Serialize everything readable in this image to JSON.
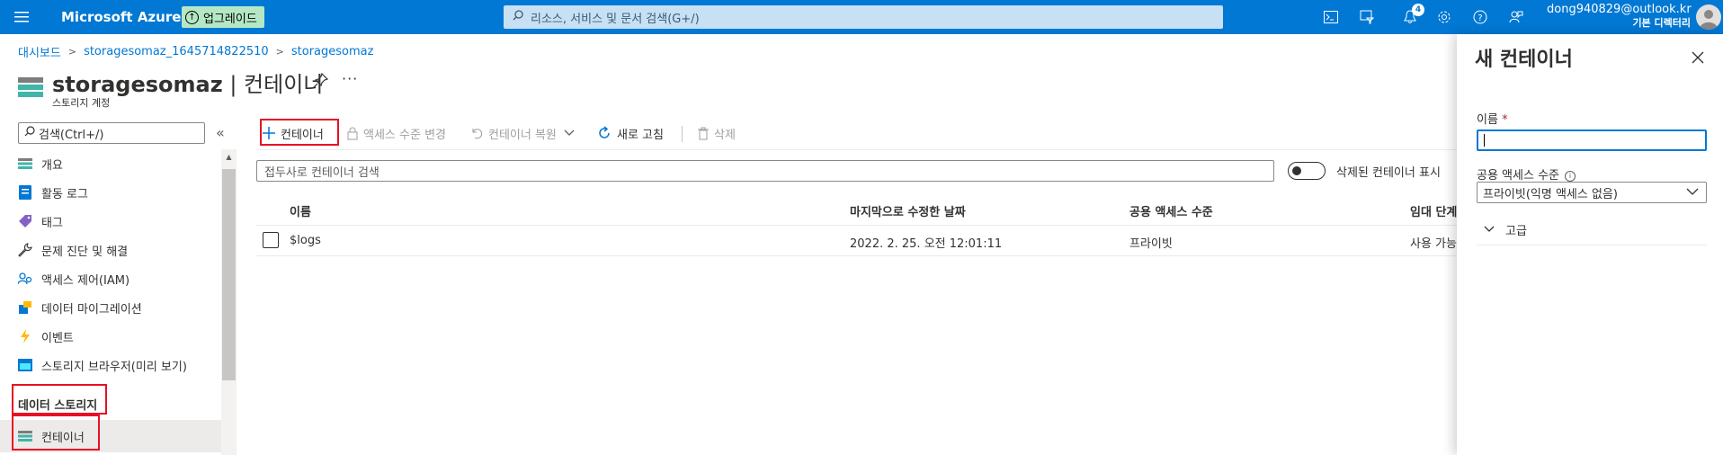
{
  "topbar": {
    "brand": "Microsoft Azure",
    "upgrade_label": "업그레이드",
    "search_placeholder": "리소스, 서비스 및 문서 검색(G+/)",
    "notification_count": "4",
    "user_email": "dong940829@outlook.kr",
    "user_directory": "기본 디렉터리",
    "icons": [
      "cloud-shell-icon",
      "directory-filter-icon",
      "notifications-icon",
      "settings-icon",
      "help-icon",
      "feedback-icon"
    ]
  },
  "breadcrumb": [
    "대시보드",
    "storagesomaz_1645714822510",
    "storagesomaz"
  ],
  "header": {
    "resource_name": "storagesomaz",
    "section": " | 컨테이너",
    "subtitle": "스토리지 계정"
  },
  "sidebar": {
    "search_placeholder": "검색(Ctrl+/)",
    "items": [
      {
        "label": "개요",
        "icon": "overview-icon"
      },
      {
        "label": "활동 로그",
        "icon": "activity-log-icon"
      },
      {
        "label": "태그",
        "icon": "tag-icon"
      },
      {
        "label": "문제 진단 및 해결",
        "icon": "wrench-icon"
      },
      {
        "label": "액세스 제어(IAM)",
        "icon": "iam-icon"
      },
      {
        "label": "데이터 마이그레이션",
        "icon": "migration-icon"
      },
      {
        "label": "이벤트",
        "icon": "lightning-icon"
      },
      {
        "label": "스토리지 브라우저(미리 보기)",
        "icon": "storage-browser-icon"
      }
    ],
    "section_label": "데이터 스토리지",
    "selected_item": {
      "label": "컨테이너",
      "icon": "container-icon"
    }
  },
  "toolbar": {
    "add_container": "컨테이너",
    "change_access": "액세스 수준 변경",
    "restore_container": "컨테이너 복원",
    "refresh": "새로 고침",
    "delete": "삭제"
  },
  "filter": {
    "search_placeholder": "접두사로 컨테이너 검색",
    "show_deleted_label": "삭제된 컨테이너 표시",
    "show_deleted_on": false
  },
  "table": {
    "columns": [
      "이름",
      "마지막으로 수정한 날짜",
      "공용 액세스 수준",
      "임대 단계"
    ],
    "rows": [
      {
        "name": "$logs",
        "modified": "2022. 2. 25. 오전 12:01:11",
        "access": "프라이빗",
        "lease": "사용 가능"
      }
    ]
  },
  "panel": {
    "title": "새 컨테이너",
    "name_label": "이름",
    "name_required": "*",
    "name_value": "",
    "access_label": "공용 액세스 수준",
    "access_value": "프라이빗(익명 액세스 없음)",
    "advanced_label": "고급"
  },
  "colors": {
    "accent": "#0078d4",
    "highlight": "#e81123",
    "upgrade_bg": "#b4e8c4"
  }
}
